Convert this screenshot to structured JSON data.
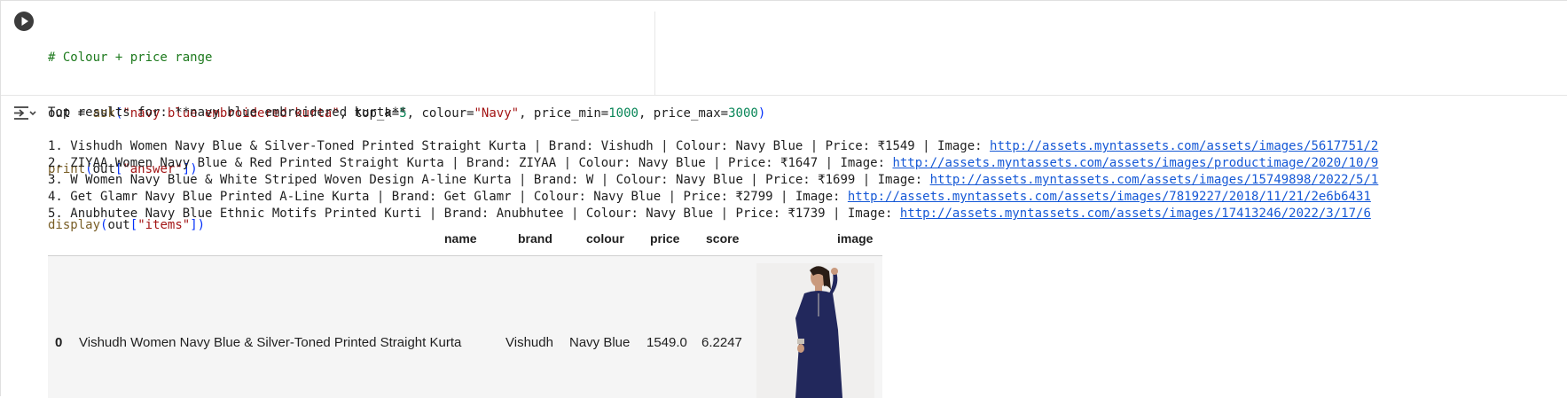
{
  "code": {
    "comment": "# Colour + price range",
    "line2": {
      "var": "out",
      "assign": " = ",
      "func": "ask",
      "open": "(",
      "query": "\"navy blue embroidered kurta\"",
      "sep1": ", top_k=",
      "top_k": "5",
      "sep2": ", colour=",
      "colour": "\"Navy\"",
      "sep3": ", price_min=",
      "price_min": "1000",
      "sep4": ", price_max=",
      "price_max": "3000",
      "close": ")"
    },
    "line3": {
      "func": "print",
      "open": "(",
      "obj": "out",
      "lb": "[",
      "key": "\"answer\"",
      "rb": "]",
      "close": ")"
    },
    "line4": {
      "func": "display",
      "open": "(",
      "obj": "out",
      "lb": "[",
      "key": "\"items\"",
      "rb": "]",
      "close": ")"
    }
  },
  "output": {
    "heading": "Top results for: **navy blue embroidered kurta**",
    "results": [
      {
        "text": "1. Vishudh Women Navy Blue & Silver-Toned Printed Straight Kurta | Brand: Vishudh | Colour: Navy Blue | Price: ₹1549 | Image: ",
        "link": "http://assets.myntassets.com/assets/images/5617751/2"
      },
      {
        "text": "2. ZIYAA Women Navy Blue & Red Printed Straight Kurta | Brand: ZIYAA | Colour: Navy Blue | Price: ₹1647 | Image: ",
        "link": "http://assets.myntassets.com/assets/images/productimage/2020/10/9"
      },
      {
        "text": "3. W Women Navy Blue & White Striped Woven Design A-line Kurta | Brand: W | Colour: Navy Blue | Price: ₹1699 | Image: ",
        "link": "http://assets.myntassets.com/assets/images/15749898/2022/5/1"
      },
      {
        "text": "4. Get Glamr Navy Blue Printed A-Line Kurta | Brand: Get Glamr | Colour: Navy Blue | Price: ₹2799 | Image: ",
        "link": "http://assets.myntassets.com/assets/images/7819227/2018/11/21/2e6b6431"
      },
      {
        "text": "5. Anubhutee Navy Blue Ethnic Motifs Printed Kurti | Brand: Anubhutee | Colour: Navy Blue | Price: ₹1739 | Image: ",
        "link": "http://assets.myntassets.com/assets/images/17413246/2022/3/17/6"
      }
    ]
  },
  "table": {
    "columns": [
      "name",
      "brand",
      "colour",
      "price",
      "score",
      "image"
    ],
    "row": {
      "index": "0",
      "name": "Vishudh Women Navy Blue & Silver-Toned Printed Straight Kurta",
      "brand": "Vishudh",
      "colour": "Navy Blue",
      "price": "1549.0",
      "score": "6.2247"
    }
  },
  "colors": {
    "link": "#1558d6",
    "comment": "#1e7a1e",
    "string": "#a31515",
    "number": "#098658",
    "row_bg": "#f5f5f5"
  },
  "icons": {
    "run": "play-circle-icon",
    "output_toggle": "output-collapse-icon",
    "thumbnail": "kurta-product-image"
  }
}
